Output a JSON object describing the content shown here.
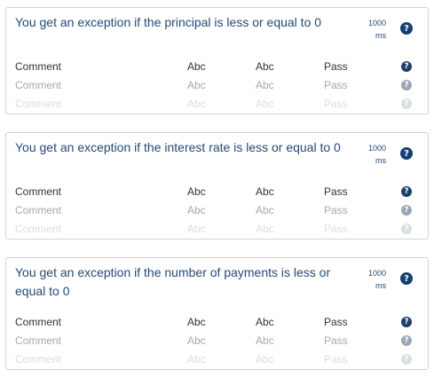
{
  "cards": [
    {
      "title": "You get an exception if  the principal is less or equal to 0",
      "timing_value": "1000",
      "timing_unit": "ms",
      "rows": [
        {
          "name": "Comment",
          "col_a": "Abc",
          "col_b": "Abc",
          "status": "Pass"
        },
        {
          "name": "Comment",
          "col_a": "Abc",
          "col_b": "Abc",
          "status": "Pass"
        },
        {
          "name": "Comment",
          "col_a": "Abc",
          "col_b": "Abc",
          "status": "Pass"
        }
      ]
    },
    {
      "title": "You get an exception if  the interest rate  is less or equal to 0",
      "timing_value": "1000",
      "timing_unit": "ms",
      "rows": [
        {
          "name": "Comment",
          "col_a": "Abc",
          "col_b": "Abc",
          "status": "Pass"
        },
        {
          "name": "Comment",
          "col_a": "Abc",
          "col_b": "Abc",
          "status": "Pass"
        },
        {
          "name": "Comment",
          "col_a": "Abc",
          "col_b": "Abc",
          "status": "Pass"
        }
      ]
    },
    {
      "title": "You get an exception if  the number of payments is less or equal to 0",
      "timing_value": "1000",
      "timing_unit": "ms",
      "rows": [
        {
          "name": "Comment",
          "col_a": "Abc",
          "col_b": "Abc",
          "status": "Pass"
        },
        {
          "name": "Comment",
          "col_a": "Abc",
          "col_b": "Abc",
          "status": "Pass"
        },
        {
          "name": "Comment",
          "col_a": "Abc",
          "col_b": "Abc",
          "status": "Pass"
        }
      ]
    }
  ],
  "help_icon_glyph": "?",
  "colors": {
    "title_text": "#234a78",
    "help_icon": "#163e73",
    "card_border": "#d3d3d3"
  }
}
